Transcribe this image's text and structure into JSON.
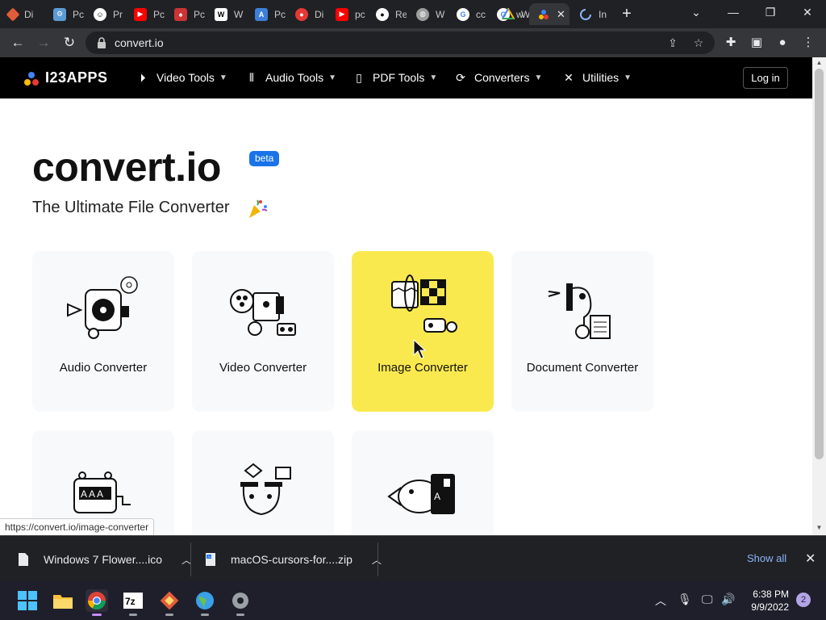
{
  "browser": {
    "tabs": [
      {
        "title": "Di",
        "icon": "diamond-red",
        "color": "#e25c3a"
      },
      {
        "title": "Pc",
        "icon": "gear-blue",
        "color": "#5b9bd5"
      },
      {
        "title": "Pr",
        "icon": "smiley",
        "color": "#ffffff"
      },
      {
        "title": "Pc",
        "icon": "youtube",
        "color": "#ff0000"
      },
      {
        "title": "Pc",
        "icon": "cards",
        "color": "#cc3333"
      },
      {
        "title": "W",
        "icon": "book",
        "color": "#ffffff"
      },
      {
        "title": "Pc",
        "icon": "ae-blue",
        "color": "#3d7fd9"
      },
      {
        "title": "Di",
        "icon": "pokeball",
        "color": "#e53935"
      },
      {
        "title": "pc",
        "icon": "youtube",
        "color": "#ff0000"
      },
      {
        "title": "Re",
        "icon": "github",
        "color": "#ffffff"
      },
      {
        "title": "W",
        "icon": "globe",
        "color": "#9e9e9e"
      },
      {
        "title": "cc",
        "icon": "google",
        "color": "#4285f4"
      },
      {
        "title": "w",
        "icon": "google",
        "color": "#4285f4"
      },
      {
        "title": "W",
        "icon": "drive",
        "color": "#fbbc04"
      },
      {
        "title": "",
        "icon": "convertio-active",
        "color": "#35363a"
      },
      {
        "title": "In",
        "icon": "loading",
        "color": "#8ab4f8"
      }
    ],
    "url": "convert.io"
  },
  "site": {
    "logo_text": "I23APPS",
    "nav": [
      {
        "label": "Video Tools",
        "icon": "play-icon"
      },
      {
        "label": "Audio Tools",
        "icon": "waveform-icon"
      },
      {
        "label": "PDF Tools",
        "icon": "document-icon"
      },
      {
        "label": "Converters",
        "icon": "refresh-icon"
      },
      {
        "label": "Utilities",
        "icon": "tools-icon"
      }
    ],
    "login_label": "Log in"
  },
  "hero": {
    "title": "convert.io",
    "badge": "beta",
    "subtitle": "The Ultimate File Converter"
  },
  "cards": [
    {
      "label": "Audio Converter"
    },
    {
      "label": "Video Converter"
    },
    {
      "label": "Image Converter"
    },
    {
      "label": "Document Converter"
    },
    {
      "label": ""
    },
    {
      "label": ""
    },
    {
      "label": ""
    }
  ],
  "status_url": "https://convert.io/image-converter",
  "downloads": [
    {
      "name": "Windows 7 Flower....ico"
    },
    {
      "name": "macOS-cursors-for....zip"
    }
  ],
  "downloads_show_all": "Show all",
  "taskbar": {
    "time": "6:38 PM",
    "date": "9/9/2022",
    "notifications": "2"
  },
  "colors": {
    "highlight": "#f9e94f",
    "badge": "#1a73e8",
    "nav_bg": "#000000"
  }
}
